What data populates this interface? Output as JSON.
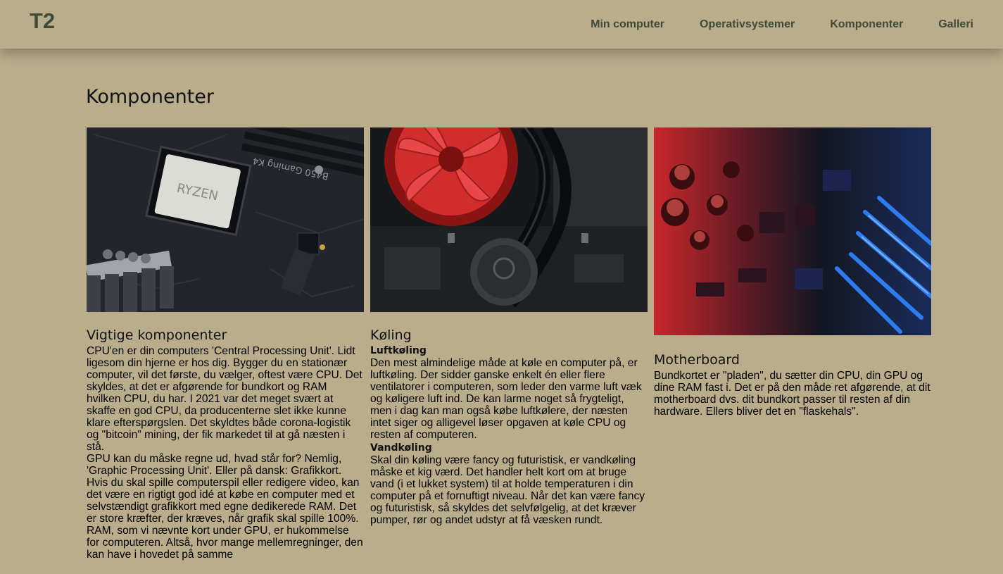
{
  "header": {
    "logo": "T2",
    "nav": [
      "Min computer",
      "Operativsystemer",
      "Komponenter",
      "Galleri"
    ]
  },
  "page": {
    "title": "Komponenter"
  },
  "cards": [
    {
      "title": "Vigtige komponenter",
      "paragraphs": [
        "CPU'en er din computers 'Central Processing Unit'. Lidt ligesom din hjerne er hos dig. Bygger du en stationær computer, vil det første, du vælger, oftest være CPU. Det skyldes, at det er afgørende for bundkort og RAM hvilken CPU, du har. I 2021 var det meget svært at skaffe en god CPU, da producenterne slet ikke kunne klare efterspørgslen. Det skyldtes både corona-logistik og \"bitcoin\" mining, der fik markedet til at gå næsten i stå.",
        "GPU kan du måske regne ud, hvad står for? Nemlig, 'Graphic Processing Unit'. Eller på dansk: Grafikkort. Hvis du skal spille computerspil eller redigere video, kan det være en rigtigt god idé at købe en computer med et selvstændigt grafikkort med egne dedikerede RAM. Det er store kræfter, der kræves, når grafik skal spille 100%.",
        "RAM, som vi nævnte kort under GPU, er hukommelse for computeren. Altså, hvor mange mellemregninger, den kan have i hovedet på samme"
      ]
    },
    {
      "title": "Køling",
      "sections": [
        {
          "subtitle": "Luftkøling",
          "text": "Den mest almindelige måde at køle en computer på, er luftkøling. Der sidder ganske enkelt én eller flere ventilatorer i computeren, som leder den varme luft væk og køligere luft ind. De kan larme noget så frygteligt, men i dag kan man også købe luftkølere, der næsten intet siger og alligevel løser opgaven at køle CPU og resten af computeren."
        },
        {
          "subtitle": "Vandkøling",
          "text": "Skal din køling være fancy og futuristisk, er vandkøling måske et kig værd. Det handler helt kort om at bruge vand (i et lukket system) til at holde temperaturen i din computer på et fornuftigt niveau. Når det kan være fancy og futuristisk, så skyldes det selvfølgelig, at det kræver pumper, rør og andet udstyr at få væsken rundt."
        }
      ]
    },
    {
      "title": "Motherboard",
      "paragraphs": [
        "Bundkortet er \"pladen\", du sætter din CPU, din GPU og dine RAM fast i. Det er på den måde ret afgørende, at dit motherboard dvs. dit bundkort passer til resten af din hardware. Ellers bliver det en \"flaskehals\"."
      ]
    }
  ],
  "images": {
    "cpu_chip_text": "RYZEN",
    "board_text": "B450 Gaming K4"
  },
  "colors": {
    "background": "#b9ad8c",
    "nav_text": "#3e4a3a"
  }
}
